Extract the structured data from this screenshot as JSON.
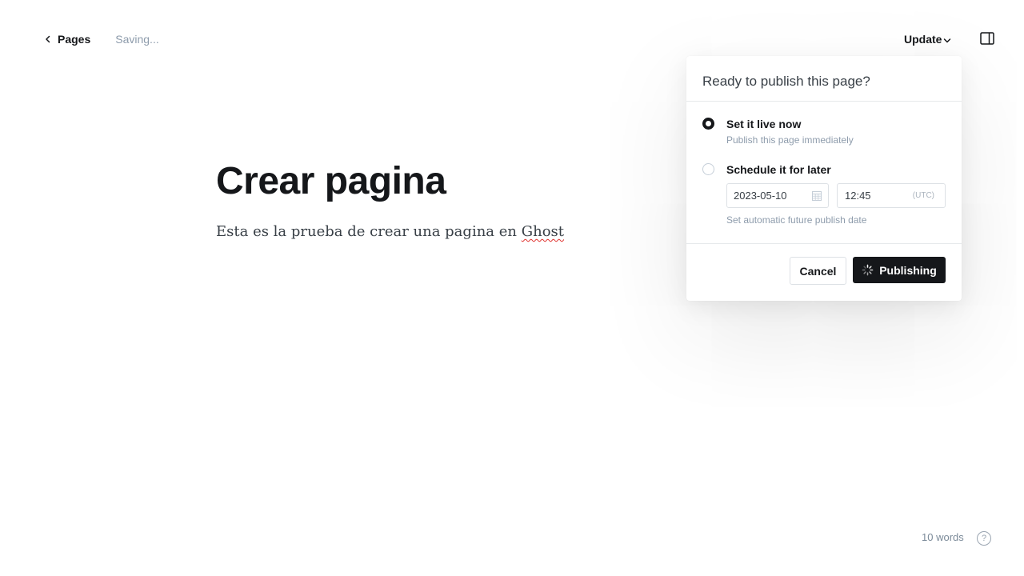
{
  "header": {
    "back_label": "Pages",
    "status_text": "Saving...",
    "update_label": "Update"
  },
  "editor": {
    "title": "Crear pagina",
    "body_text_prefix": "Esta es la prueba de crear una pagina en ",
    "body_text_misspelled": "Ghost"
  },
  "publish_panel": {
    "title": "Ready to publish this page?",
    "options": [
      {
        "label": "Set it live now",
        "description": "Publish this page immediately",
        "selected": true
      },
      {
        "label": "Schedule it for later",
        "description": "Set automatic future publish date",
        "selected": false
      }
    ],
    "date_value": "2023-05-10",
    "time_value": "12:45",
    "timezone_label": "(UTC)",
    "cancel_label": "Cancel",
    "publish_label": "Publishing"
  },
  "footer": {
    "word_count": "10 words",
    "help_glyph": "?"
  },
  "icons": {
    "back": "chevron-left-icon",
    "update_dropdown": "chevron-down-icon",
    "sidebar": "sidebar-toggle-icon",
    "calendar": "calendar-icon",
    "spinner": "spinner-icon",
    "help": "help-icon"
  },
  "colors": {
    "text_primary": "#15171a",
    "text_muted": "#8e9cac",
    "button_dark": "#15171a",
    "spellcheck_underline": "#e0322f"
  }
}
